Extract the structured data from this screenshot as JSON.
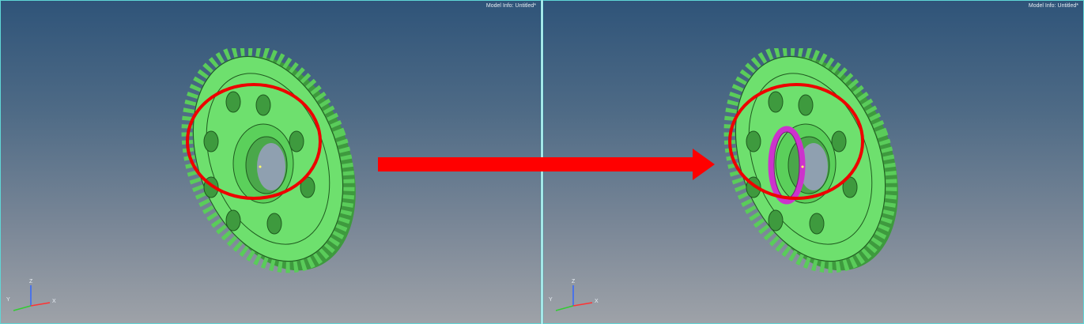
{
  "viewports": [
    {
      "model_info_label": "Model Info:",
      "model_info_value": "Untitled*",
      "axes": {
        "z": "Z",
        "y": "Y",
        "x": "X"
      }
    },
    {
      "model_info_label": "Model Info:",
      "model_info_value": "Untitled*",
      "axes": {
        "z": "Z",
        "y": "Y",
        "x": "X"
      }
    }
  ],
  "colors": {
    "gear": "#66dd66",
    "highlight_ring": "#ee0000",
    "arrow": "#ff0000",
    "selected_face": "#cc33cc"
  },
  "icons": [
    "gear-model",
    "axis-triad-icon",
    "transition-arrow-icon"
  ]
}
